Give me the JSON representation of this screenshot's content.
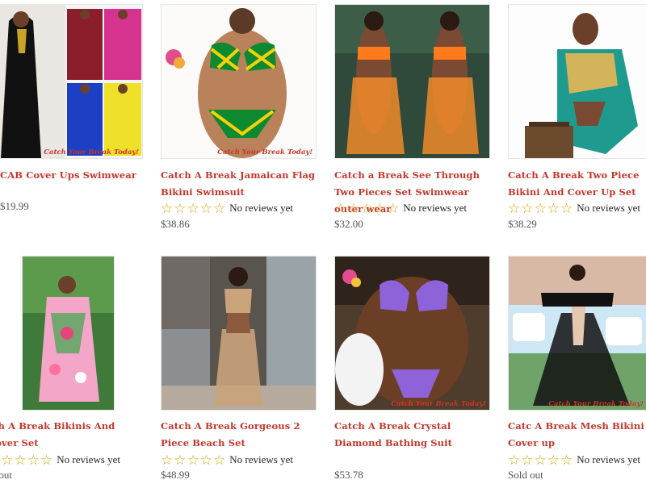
{
  "products": [
    {
      "title": "CAB Cover Ups Swimwear",
      "rating_text": "",
      "price": "$19.99",
      "image": "multicolor-cover-up-photo",
      "watermark": "Catch Your Break Today!",
      "stars": 0
    },
    {
      "title": "Catch A Break Jamaican Flag Bikini Swimsuit",
      "rating_text": "No reviews yet",
      "price": "$38.86",
      "image": "jamaican-flag-bikini-photo",
      "watermark": "Catch Your Break Today!",
      "stars": 0
    },
    {
      "title": "Catch a Break See Through Two Pieces Set Swimwear outer wear",
      "rating_text": "No reviews yet",
      "price": "$32.00",
      "image": "orange-fringe-set-photo",
      "watermark": "",
      "stars": 0
    },
    {
      "title": "Catch A Break Two Piece Bikini And Cover Up Set",
      "rating_text": "No reviews yet",
      "price": "$38.29",
      "image": "patterned-cover-up-photo",
      "watermark": "",
      "stars": 0
    },
    {
      "title": "tch A Break Bikinis And Cover Set",
      "rating_text": "No reviews yet",
      "price": "ld out",
      "image": "floral-cover-photo",
      "watermark": "",
      "stars": 0
    },
    {
      "title": "Catch A Break Gorgeous 2 Piece Beach Set",
      "rating_text": "No reviews yet",
      "price": "$48.99",
      "image": "fringe-beach-set-photo",
      "watermark": "",
      "stars": 0
    },
    {
      "title": "Catch A Break Crystal Diamond Bathing Suit",
      "rating_text": "",
      "price": "$53.78",
      "image": "purple-bikini-photo",
      "watermark": "Catch Your Break Today!",
      "stars": 0
    },
    {
      "title": "Catc A Break Mesh Bikini Cover up",
      "rating_text": "No reviews yet",
      "price": "Sold out",
      "image": "mesh-cover-up-photo",
      "watermark": "Catch Your Break Today!",
      "stars": 0
    }
  ],
  "colors": {
    "title": "#c8352b",
    "star": "#d9a514",
    "price": "#555555"
  }
}
